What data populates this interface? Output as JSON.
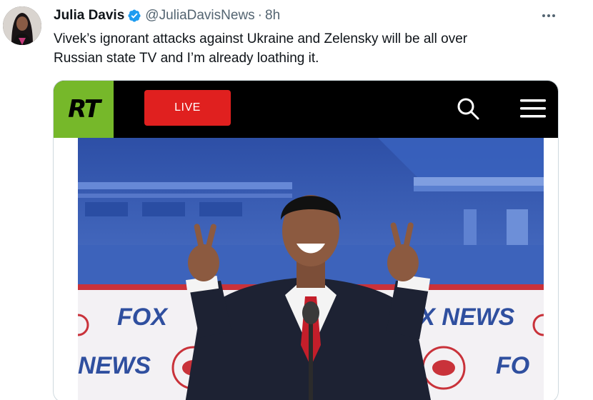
{
  "tweet": {
    "author_name": "Julia Davis",
    "handle": "@JuliaDavisNews",
    "separator": "·",
    "time": "8h",
    "text_line1": "Vivek’s ignorant attacks against Ukraine and Zelensky will be all over",
    "text_line2": "Russian state TV and I’m already loathing it."
  },
  "media": {
    "logo_text": "RT",
    "live_label": "LIVE",
    "icons": [
      "search-icon",
      "menu-icon"
    ],
    "photo_texts": {
      "fox_left": "FOX",
      "fox_news_right": "FOX NEWS",
      "news_left": "NEWS",
      "fox_right": "FO"
    }
  },
  "colors": {
    "verified_blue": "#1d9bf0",
    "rt_green": "#76b82a",
    "live_red": "#e0201f",
    "stage_blue": "#3a5fb8"
  }
}
